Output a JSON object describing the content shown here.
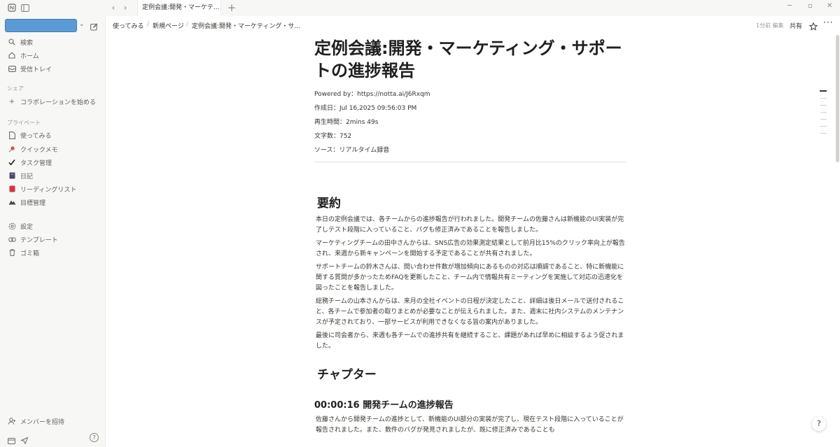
{
  "window": {
    "tab_title": "定例会議:開発・マーケテ..."
  },
  "sidebar": {
    "top_items": [
      {
        "icon": "search-icon",
        "label": "検索"
      },
      {
        "icon": "home-icon",
        "label": "ホーム"
      },
      {
        "icon": "inbox-icon",
        "label": "受信トレイ"
      }
    ],
    "share_heading": "シェア",
    "share_item": "コラボレーションを始める",
    "private_heading": "プライベート",
    "private_items": [
      {
        "icon": "page-icon",
        "label": "使ってみる"
      },
      {
        "icon": "pin-icon",
        "label": "クイックメモ"
      },
      {
        "icon": "check-icon",
        "label": "タスク管理"
      },
      {
        "icon": "journal-icon",
        "label": "日記"
      },
      {
        "icon": "book-icon",
        "label": "リーディングリスト"
      },
      {
        "icon": "mountain-icon",
        "label": "目標管理"
      }
    ],
    "bottom_items": [
      {
        "icon": "gear-icon",
        "label": "設定"
      },
      {
        "icon": "template-icon",
        "label": "テンプレート"
      },
      {
        "icon": "trash-icon",
        "label": "ゴミ箱"
      }
    ],
    "invite_label": "メンバーを招待"
  },
  "header": {
    "breadcrumb": [
      "使ってみる",
      "新規ページ",
      "定例会議:開発・マーケティング・サ..."
    ],
    "edited": "1分前 編集",
    "share": "共有"
  },
  "page": {
    "title": "定例会議:開発・マーケティング・サポートの進捗報告",
    "meta": [
      "Powered by：https://notta.ai/J6Rxqm",
      "作成日：Jul 16,2025 09:56:03 PM",
      "再生時間：2mins 49s",
      "文字数：752",
      "ソース：リアルタイム録音"
    ],
    "summary_heading": "要約",
    "summary_paragraphs": [
      "本日の定例会議では、各チームからの進捗報告が行われました。開発チームの佐藤さんは新機能のUI実装が完了しテスト段階に入っていること、バグも修正済みであることを報告しました。",
      "マーケティングチームの田中さんからは、SNS広告の効果測定結果として前月比15%のクリック率向上が報告され、来週から新キャンペーンを開始する予定であることが共有されました。",
      "サポートチームの鈴木さんは、問い合わせ件数が増加傾向にあるものの対応は順調であること、特に新機能に関する質問が多かったためFAQを更新したこと、チーム内で情報共有ミーティングを実施して対応の迅速化を図ったことを報告しました。",
      "総務チームの山本さんからは、来月の全社イベントの日程が決定したこと、詳細は後日メールで送付されること、各チームで参加者の取りまとめが必要なことが伝えられました。また、週末に社内システムのメンテナンスが予定されており、一部サービスが利用できなくなる旨の案内がありました。",
      "最後に司会者から、来週も各チームでの進捗共有を継続すること、課題があれば早めに相談するよう促されました。"
    ],
    "chapter_heading": "チャプター",
    "chapter_title": "00:00:16 開発チームの進捗報告",
    "chapter_text": "佐藤さんから開発チームの進捗として、新機能のUI部分の実装が完了し、現在テスト段階に入っていることが報告されました。また、数件のバグが発見されましたが、既に修正済みであることも"
  },
  "colors": {
    "sidebar_bg": "#f7f7f5",
    "workspace_box": "#5b9bd5"
  }
}
